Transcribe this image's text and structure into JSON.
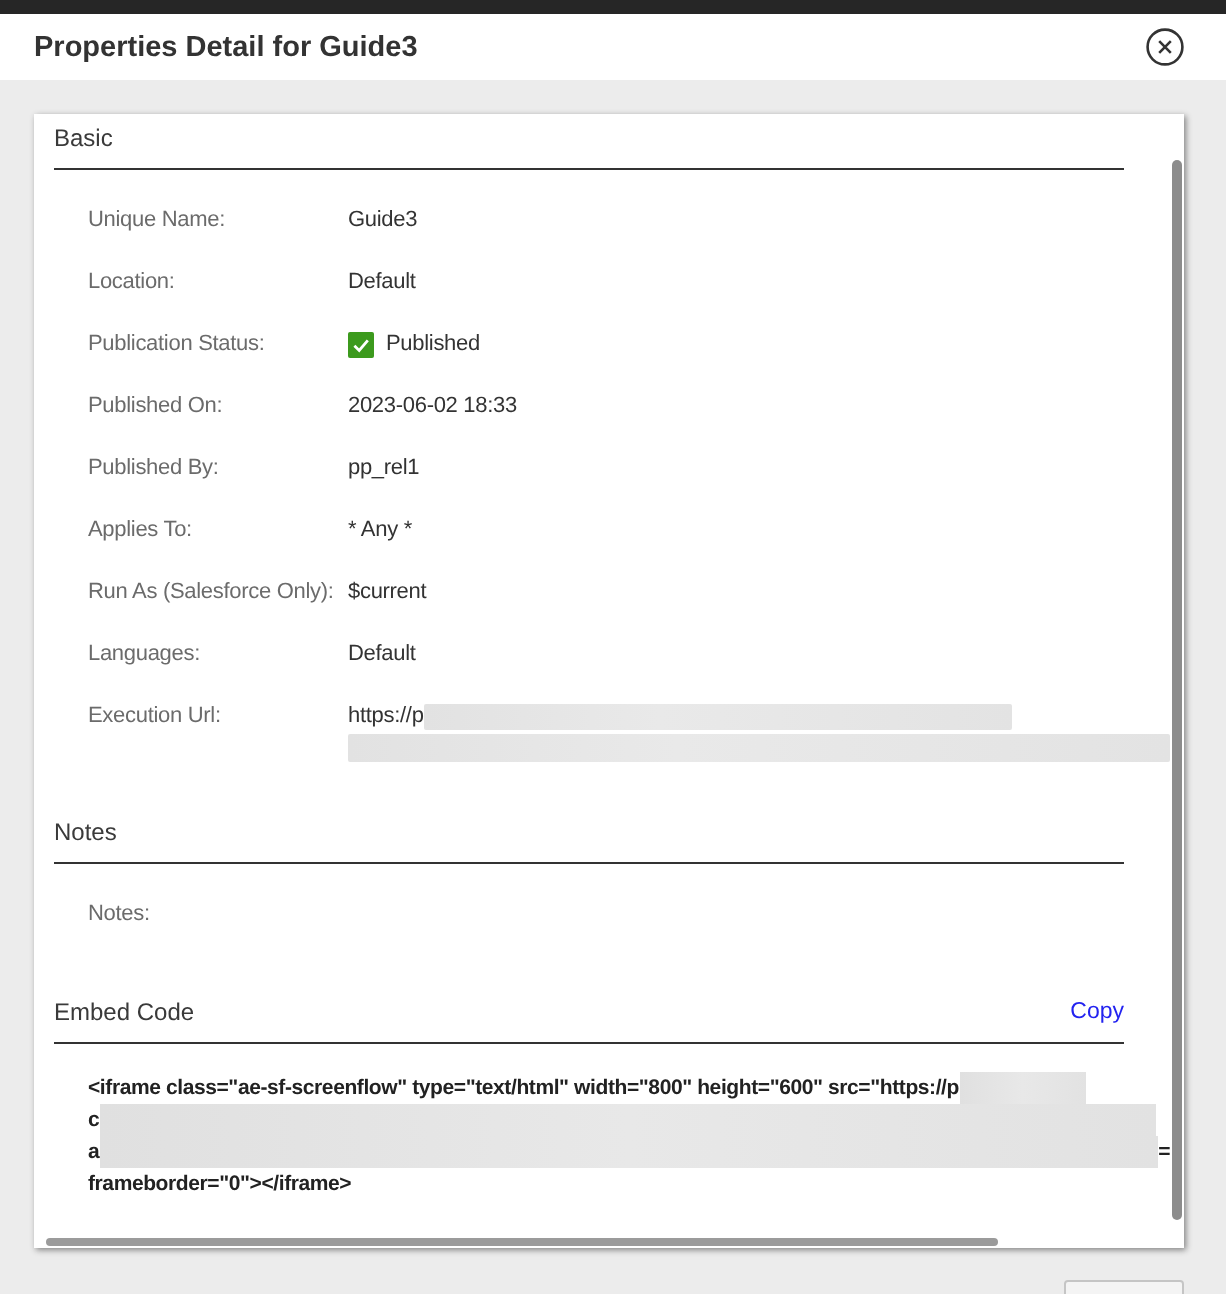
{
  "dialog": {
    "title": "Properties Detail for Guide3"
  },
  "sections": [
    {
      "heading": "Basic",
      "fields": [
        {
          "label": "Unique Name:",
          "kind": "text",
          "value": "Guide3"
        },
        {
          "label": "Location:",
          "kind": "text",
          "value": "Default"
        },
        {
          "label": "Publication Status:",
          "kind": "status",
          "value": "Published",
          "checked": true
        },
        {
          "label": "Published On:",
          "kind": "text",
          "value": "2023-06-02 18:33"
        },
        {
          "label": "Published By:",
          "kind": "text",
          "value": "pp_rel1"
        },
        {
          "label": "Applies To:",
          "kind": "text",
          "value": "* Any *"
        },
        {
          "label": "Run As (Salesforce Only):",
          "kind": "text",
          "value": "$current"
        },
        {
          "label": "Languages:",
          "kind": "text",
          "value": "Default"
        },
        {
          "label": "Execution Url:",
          "kind": "url",
          "lines": [
            {
              "segments": [
                {
                  "kind": "text",
                  "text": "https://p"
                },
                {
                  "kind": "redacted"
                }
              ]
            },
            {
              "segments": [
                {
                  "kind": "redacted"
                }
              ]
            }
          ]
        }
      ]
    },
    {
      "heading": "Notes",
      "fields": [
        {
          "label": "Notes:",
          "kind": "text"
        }
      ]
    }
  ],
  "embed": {
    "heading": "Embed Code",
    "action": "Copy",
    "code_lines": [
      {
        "segments": [
          {
            "kind": "text",
            "text": "<iframe class=\"ae-sf-screenflow\" type=\"text/html\" width=\"800\" height=\"600\" src=\"https://p"
          },
          {
            "kind": "redacted"
          }
        ]
      },
      {
        "segments": [
          {
            "kind": "text",
            "text": "c"
          },
          {
            "kind": "redacted"
          }
        ]
      },
      {
        "segments": [
          {
            "kind": "text",
            "text": "a"
          },
          {
            "kind": "redacted"
          },
          {
            "kind": "text",
            "text": "="
          }
        ]
      },
      {
        "segments": [
          {
            "kind": "text",
            "text": "frameborder=\"0\"></iframe>"
          }
        ]
      }
    ]
  }
}
